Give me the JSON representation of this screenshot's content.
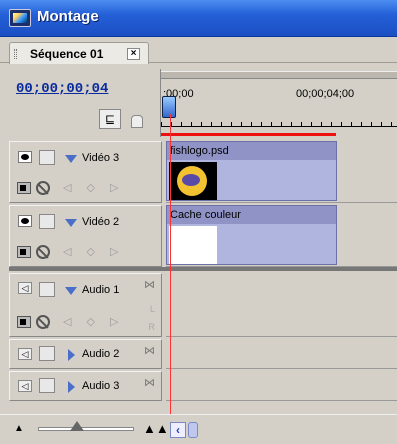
{
  "window": {
    "title": "Montage"
  },
  "tab": {
    "label": "Séquence 01",
    "close_glyph": "×"
  },
  "header": {
    "timecode": "00;00;00;04"
  },
  "ruler": {
    "start_label": ":00;00",
    "end_label": "00;00;04;00"
  },
  "tracks": {
    "video3": {
      "name": "Vidéo 3",
      "clip": "fishlogo.psd"
    },
    "video2": {
      "name": "Vidéo 2",
      "clip": "Cache couleur"
    },
    "audio1": {
      "name": "Audio 1",
      "l": "L",
      "r": "R"
    },
    "audio2": {
      "name": "Audio 2"
    },
    "audio3": {
      "name": "Audio 3"
    }
  },
  "keyframe_nav": {
    "glyphs": "◁ ◇ ▷"
  },
  "colors": {
    "title_bar": "#2460d8",
    "clip": "#b0b5df",
    "playhead_line": "#ff3333",
    "work_area": "#ee1111"
  }
}
